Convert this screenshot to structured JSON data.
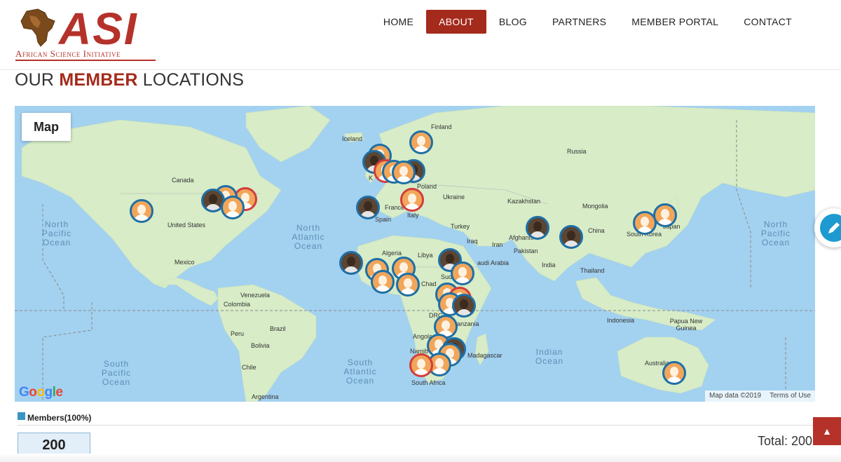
{
  "brand": {
    "logo_text": "ASI",
    "subtitle": "African Science Initiative",
    "color": "#b5322a"
  },
  "nav": {
    "items": [
      {
        "label": "HOME",
        "active": false
      },
      {
        "label": "ABOUT",
        "active": true
      },
      {
        "label": "BLOG",
        "active": false
      },
      {
        "label": "PARTNERS",
        "active": false
      },
      {
        "label": "MEMBER PORTAL",
        "active": false
      },
      {
        "label": "CONTACT",
        "active": false
      }
    ],
    "active_color": "#a42b1c"
  },
  "page": {
    "title_prefix": "OUR ",
    "title_highlight": "MEMBER",
    "title_suffix": " LOCATIONS"
  },
  "map": {
    "type_button": "Map",
    "attribution": "Map data ©2019",
    "terms": "Terms of Use",
    "provider_logo": "Google",
    "labels": {
      "iceland": "Iceland",
      "finland": "Finland",
      "russia": "Russia",
      "canada": "Canada",
      "poland": "Poland",
      "ukraine": "Ukraine",
      "kazakhstan": "Kazakhstan",
      "mongolia": "Mongolia",
      "us": "United States",
      "france": "France",
      "italy": "Italy",
      "spain": "Spain",
      "turkey": "Turkey",
      "iraq": "Iraq",
      "iran": "Iran",
      "afghanistan": "Afghanis",
      "pakistan": "Pakistan",
      "china": "China",
      "japan": "Japan",
      "south_korea": "South Korea",
      "mexico": "Mexico",
      "algeria": "Algeria",
      "libya": "Libya",
      "saudi": "audi Arabia",
      "india": "India",
      "thailand": "Thailand",
      "sudan": "Sud",
      "chad": "Chad",
      "venezuela": "Venezuela",
      "colombia": "Colombia",
      "drc": "DRC",
      "tanzania": "anzania",
      "indonesia": "Indonesia",
      "png": "Papua New Guinea",
      "peru": "Peru",
      "brazil": "Brazil",
      "bolivia": "Bolivia",
      "angola": "Angola",
      "namibia": "Namib",
      "madagascar": "Madagascar",
      "chile": "Chile",
      "south_africa": "South Africa",
      "australia": "Australia",
      "argentina": "Argentina",
      "kingdom": "K"
    },
    "oceans": {
      "north_pacific_left": "North Pacific Ocean",
      "north_pacific_right": "North Pacific Ocean",
      "north_atlantic": "North Atlantic Ocean",
      "south_pacific": "South Pacific Ocean",
      "south_atlantic": "South Atlantic Ocean",
      "indian": "Indian Ocean"
    }
  },
  "legend": {
    "label": "Members(100%)",
    "color": "#3a94c4",
    "count": "200",
    "total": "Total: 200"
  }
}
